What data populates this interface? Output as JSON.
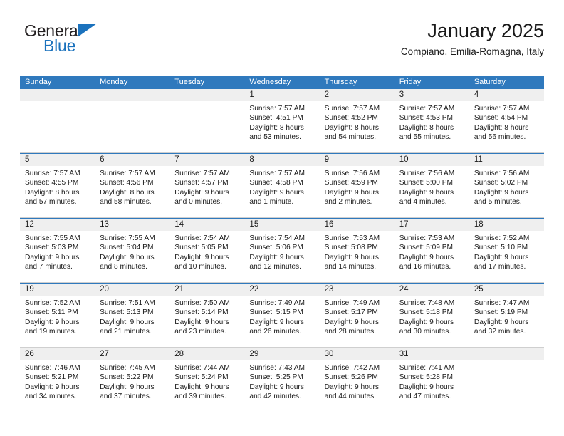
{
  "logo": {
    "word1": "General",
    "word2": "Blue",
    "triangle_color": "#1b72bd"
  },
  "header": {
    "title": "January 2025",
    "subtitle": "Compiano, Emilia-Romagna, Italy"
  },
  "theme": {
    "header_blue": "#2f79bd",
    "daynum_gray": "#efefef",
    "text": "#1a1a1a"
  },
  "weekdays": [
    "Sunday",
    "Monday",
    "Tuesday",
    "Wednesday",
    "Thursday",
    "Friday",
    "Saturday"
  ],
  "weeks": [
    [
      {
        "day": "",
        "lines": []
      },
      {
        "day": "",
        "lines": []
      },
      {
        "day": "",
        "lines": []
      },
      {
        "day": "1",
        "lines": [
          "Sunrise: 7:57 AM",
          "Sunset: 4:51 PM",
          "Daylight: 8 hours",
          "and 53 minutes."
        ]
      },
      {
        "day": "2",
        "lines": [
          "Sunrise: 7:57 AM",
          "Sunset: 4:52 PM",
          "Daylight: 8 hours",
          "and 54 minutes."
        ]
      },
      {
        "day": "3",
        "lines": [
          "Sunrise: 7:57 AM",
          "Sunset: 4:53 PM",
          "Daylight: 8 hours",
          "and 55 minutes."
        ]
      },
      {
        "day": "4",
        "lines": [
          "Sunrise: 7:57 AM",
          "Sunset: 4:54 PM",
          "Daylight: 8 hours",
          "and 56 minutes."
        ]
      }
    ],
    [
      {
        "day": "5",
        "lines": [
          "Sunrise: 7:57 AM",
          "Sunset: 4:55 PM",
          "Daylight: 8 hours",
          "and 57 minutes."
        ]
      },
      {
        "day": "6",
        "lines": [
          "Sunrise: 7:57 AM",
          "Sunset: 4:56 PM",
          "Daylight: 8 hours",
          "and 58 minutes."
        ]
      },
      {
        "day": "7",
        "lines": [
          "Sunrise: 7:57 AM",
          "Sunset: 4:57 PM",
          "Daylight: 9 hours",
          "and 0 minutes."
        ]
      },
      {
        "day": "8",
        "lines": [
          "Sunrise: 7:57 AM",
          "Sunset: 4:58 PM",
          "Daylight: 9 hours",
          "and 1 minute."
        ]
      },
      {
        "day": "9",
        "lines": [
          "Sunrise: 7:56 AM",
          "Sunset: 4:59 PM",
          "Daylight: 9 hours",
          "and 2 minutes."
        ]
      },
      {
        "day": "10",
        "lines": [
          "Sunrise: 7:56 AM",
          "Sunset: 5:00 PM",
          "Daylight: 9 hours",
          "and 4 minutes."
        ]
      },
      {
        "day": "11",
        "lines": [
          "Sunrise: 7:56 AM",
          "Sunset: 5:02 PM",
          "Daylight: 9 hours",
          "and 5 minutes."
        ]
      }
    ],
    [
      {
        "day": "12",
        "lines": [
          "Sunrise: 7:55 AM",
          "Sunset: 5:03 PM",
          "Daylight: 9 hours",
          "and 7 minutes."
        ]
      },
      {
        "day": "13",
        "lines": [
          "Sunrise: 7:55 AM",
          "Sunset: 5:04 PM",
          "Daylight: 9 hours",
          "and 8 minutes."
        ]
      },
      {
        "day": "14",
        "lines": [
          "Sunrise: 7:54 AM",
          "Sunset: 5:05 PM",
          "Daylight: 9 hours",
          "and 10 minutes."
        ]
      },
      {
        "day": "15",
        "lines": [
          "Sunrise: 7:54 AM",
          "Sunset: 5:06 PM",
          "Daylight: 9 hours",
          "and 12 minutes."
        ]
      },
      {
        "day": "16",
        "lines": [
          "Sunrise: 7:53 AM",
          "Sunset: 5:08 PM",
          "Daylight: 9 hours",
          "and 14 minutes."
        ]
      },
      {
        "day": "17",
        "lines": [
          "Sunrise: 7:53 AM",
          "Sunset: 5:09 PM",
          "Daylight: 9 hours",
          "and 16 minutes."
        ]
      },
      {
        "day": "18",
        "lines": [
          "Sunrise: 7:52 AM",
          "Sunset: 5:10 PM",
          "Daylight: 9 hours",
          "and 17 minutes."
        ]
      }
    ],
    [
      {
        "day": "19",
        "lines": [
          "Sunrise: 7:52 AM",
          "Sunset: 5:11 PM",
          "Daylight: 9 hours",
          "and 19 minutes."
        ]
      },
      {
        "day": "20",
        "lines": [
          "Sunrise: 7:51 AM",
          "Sunset: 5:13 PM",
          "Daylight: 9 hours",
          "and 21 minutes."
        ]
      },
      {
        "day": "21",
        "lines": [
          "Sunrise: 7:50 AM",
          "Sunset: 5:14 PM",
          "Daylight: 9 hours",
          "and 23 minutes."
        ]
      },
      {
        "day": "22",
        "lines": [
          "Sunrise: 7:49 AM",
          "Sunset: 5:15 PM",
          "Daylight: 9 hours",
          "and 26 minutes."
        ]
      },
      {
        "day": "23",
        "lines": [
          "Sunrise: 7:49 AM",
          "Sunset: 5:17 PM",
          "Daylight: 9 hours",
          "and 28 minutes."
        ]
      },
      {
        "day": "24",
        "lines": [
          "Sunrise: 7:48 AM",
          "Sunset: 5:18 PM",
          "Daylight: 9 hours",
          "and 30 minutes."
        ]
      },
      {
        "day": "25",
        "lines": [
          "Sunrise: 7:47 AM",
          "Sunset: 5:19 PM",
          "Daylight: 9 hours",
          "and 32 minutes."
        ]
      }
    ],
    [
      {
        "day": "26",
        "lines": [
          "Sunrise: 7:46 AM",
          "Sunset: 5:21 PM",
          "Daylight: 9 hours",
          "and 34 minutes."
        ]
      },
      {
        "day": "27",
        "lines": [
          "Sunrise: 7:45 AM",
          "Sunset: 5:22 PM",
          "Daylight: 9 hours",
          "and 37 minutes."
        ]
      },
      {
        "day": "28",
        "lines": [
          "Sunrise: 7:44 AM",
          "Sunset: 5:24 PM",
          "Daylight: 9 hours",
          "and 39 minutes."
        ]
      },
      {
        "day": "29",
        "lines": [
          "Sunrise: 7:43 AM",
          "Sunset: 5:25 PM",
          "Daylight: 9 hours",
          "and 42 minutes."
        ]
      },
      {
        "day": "30",
        "lines": [
          "Sunrise: 7:42 AM",
          "Sunset: 5:26 PM",
          "Daylight: 9 hours",
          "and 44 minutes."
        ]
      },
      {
        "day": "31",
        "lines": [
          "Sunrise: 7:41 AM",
          "Sunset: 5:28 PM",
          "Daylight: 9 hours",
          "and 47 minutes."
        ]
      },
      {
        "day": "",
        "lines": []
      }
    ]
  ]
}
